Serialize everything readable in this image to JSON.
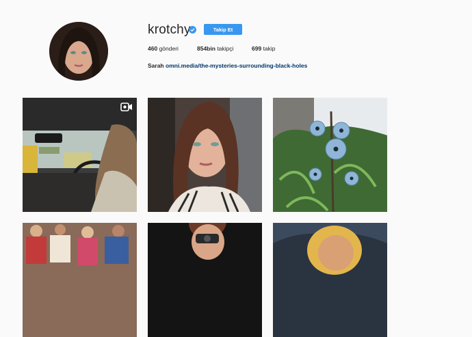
{
  "profile": {
    "username": "krotchy",
    "follow_label": "Takip Et",
    "posts_count": "460",
    "posts_label": "gönderi",
    "followers_count": "854bin",
    "followers_label": "takipçi",
    "following_count": "699",
    "following_label": "takip",
    "bio_name": "Sarah",
    "bio_link": "omni.media/the-mysteries-surrounding-black-holes"
  },
  "posts": [
    {
      "subject": "car-interior-street",
      "badge_icon": "video-icon"
    },
    {
      "subject": "portrait-selfie"
    },
    {
      "subject": "blue-flowers-ferns"
    },
    {
      "subject": "crowd-market"
    },
    {
      "subject": "woman-with-camera"
    },
    {
      "subject": "painting-portrait"
    }
  ],
  "colors": {
    "follow_button": "#3897f0",
    "verified_badge": "#3897f0",
    "link": "#003569",
    "background": "#fafafa"
  }
}
